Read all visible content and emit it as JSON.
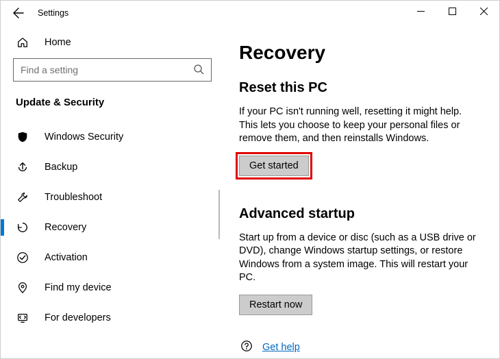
{
  "window": {
    "title": "Settings"
  },
  "sidebar": {
    "home_label": "Home",
    "search_placeholder": "Find a setting",
    "section_title": "Update & Security",
    "items": [
      {
        "label": "Windows Security",
        "icon": "shield"
      },
      {
        "label": "Backup",
        "icon": "backup"
      },
      {
        "label": "Troubleshoot",
        "icon": "wrench"
      },
      {
        "label": "Recovery",
        "icon": "recovery",
        "selected": true
      },
      {
        "label": "Activation",
        "icon": "check-circle"
      },
      {
        "label": "Find my device",
        "icon": "location"
      },
      {
        "label": "For developers",
        "icon": "developer"
      }
    ]
  },
  "main": {
    "heading": "Recovery",
    "reset": {
      "title": "Reset this PC",
      "description": "If your PC isn't running well, resetting it might help. This lets you choose to keep your personal files or remove them, and then reinstalls Windows.",
      "button": "Get started"
    },
    "advanced": {
      "title": "Advanced startup",
      "description": "Start up from a device or disc (such as a USB drive or DVD), change Windows startup settings, or restore Windows from a system image. This will restart your PC.",
      "button": "Restart now"
    },
    "help_link": "Get help"
  }
}
